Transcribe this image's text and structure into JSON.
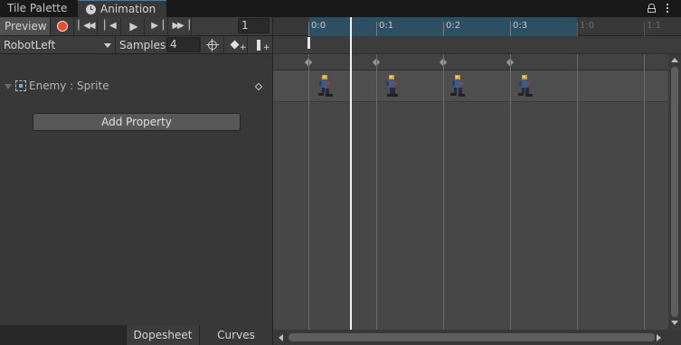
{
  "tabs": {
    "tile_palette": "Tile Palette",
    "animation": "Animation"
  },
  "toolbar": {
    "preview_label": "Preview",
    "frame_value": "1",
    "clip_name": "RobotLeft",
    "samples_label": "Samples",
    "samples_value": "4"
  },
  "properties": [
    {
      "label": "Enemy : Sprite",
      "icon": "sprite-renderer-icon"
    }
  ],
  "add_property_label": "Add Property",
  "bottom_tabs": {
    "dopesheet": "Dopesheet",
    "curves": "Curves"
  },
  "timeline": {
    "ruler_labels": [
      "0:0",
      "0:1",
      "0:2",
      "0:3",
      "1:0",
      "1:1"
    ],
    "current_frame": "1",
    "keyframes": [
      "0:0",
      "0:1",
      "0:2",
      "0:3"
    ],
    "range_color": "#2c4f63"
  },
  "colors": {
    "record": "#ef4a2b",
    "accent_tab": "#3a79bb"
  }
}
